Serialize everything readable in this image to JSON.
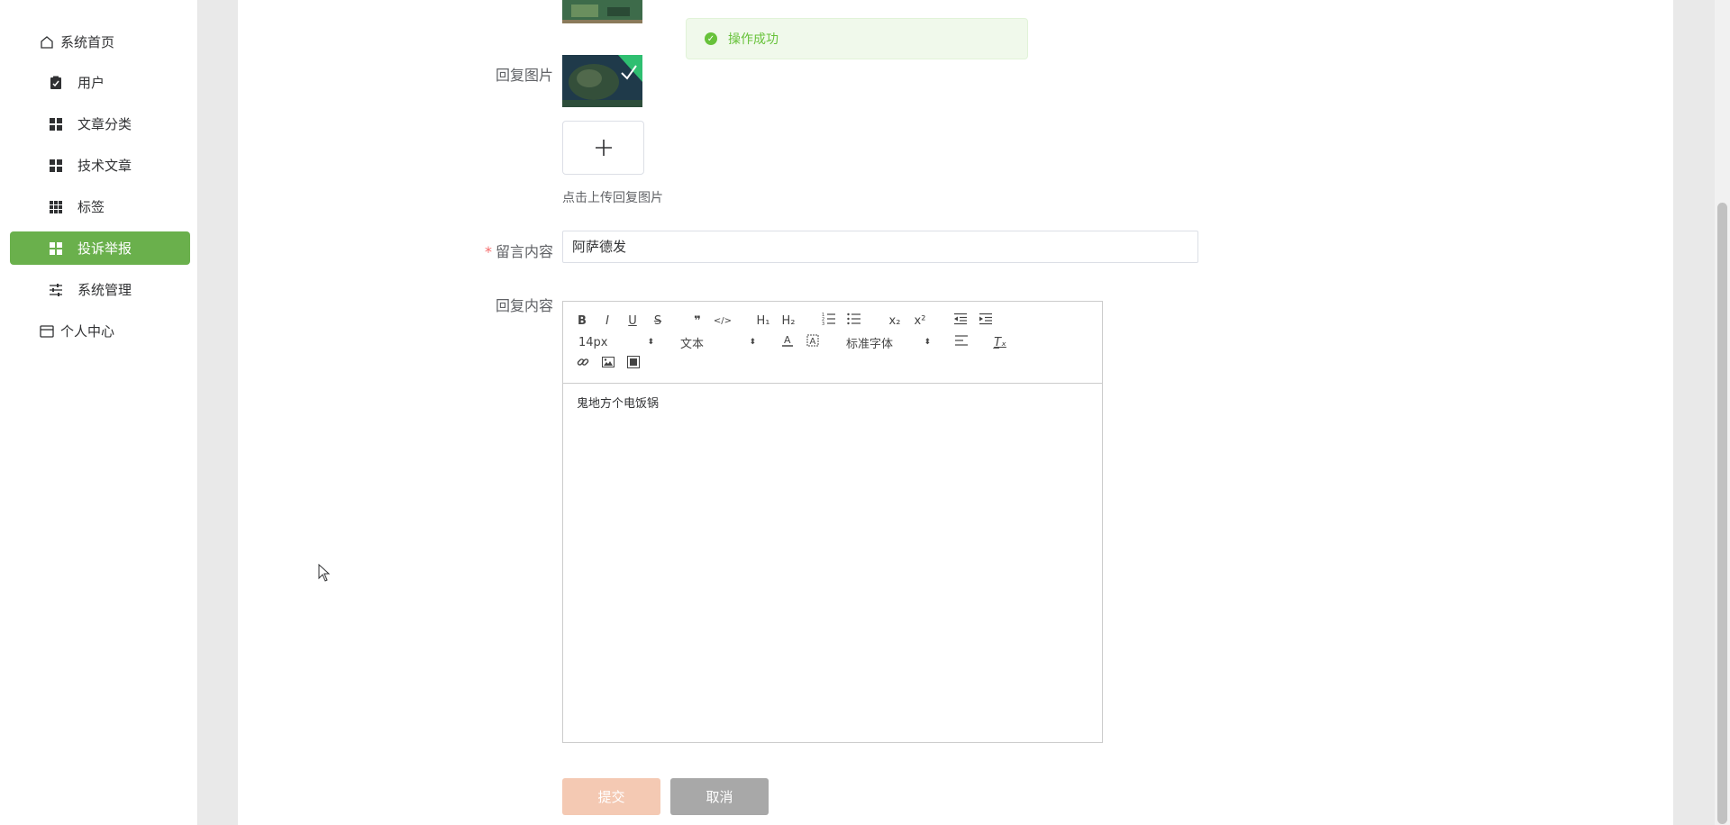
{
  "sidebar": {
    "items": [
      {
        "label": "系统首页",
        "icon": "home-icon"
      },
      {
        "label": "用户",
        "icon": "clipboard-icon"
      },
      {
        "label": "文章分类",
        "icon": "grid-icon"
      },
      {
        "label": "技术文章",
        "icon": "grid-icon"
      },
      {
        "label": "标签",
        "icon": "grid-small-icon"
      },
      {
        "label": "投诉举报",
        "icon": "grid-icon",
        "active": true
      },
      {
        "label": "系统管理",
        "icon": "sliders-icon"
      },
      {
        "label": "个人中心",
        "icon": "card-icon"
      }
    ],
    "active_color": "#6ab04c"
  },
  "toast": {
    "message": "操作成功",
    "icon": "success-check-icon"
  },
  "form": {
    "reply_image_label": "回复图片",
    "upload_tip": "点击上传回复图片",
    "upload_icon": "plus-icon",
    "message_label": "留言内容",
    "message_required_mark": "*",
    "message_value": "阿萨德发",
    "reply_label": "回复内容",
    "submit_label": "提交",
    "cancel_label": "取消"
  },
  "editor": {
    "toolbar": {
      "bold": "B",
      "italic": "I",
      "underline": "U",
      "strike": "S",
      "quote": "❞",
      "code": "</>",
      "h1": "H₁",
      "h2": "H₂",
      "ordered_list": "ordered-list-icon",
      "bullet_list": "bullet-list-icon",
      "subscript": "x₂",
      "superscript": "x²",
      "font_size": "14px",
      "header": "文本",
      "font_family": "标准字体",
      "clean": "T̲ₓ"
    },
    "content": "鬼地方个电饭锅"
  },
  "colors": {
    "toast_bg": "#f0f9eb",
    "toast_text": "#67c23a",
    "submit_bg": "#f4c9b3",
    "cancel_bg": "#a8a8a8"
  }
}
